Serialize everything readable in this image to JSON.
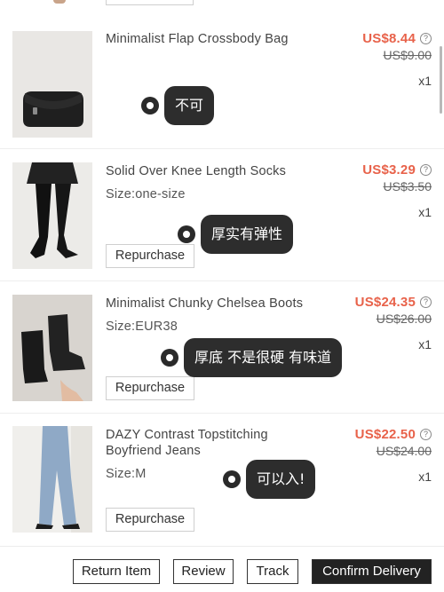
{
  "items": [
    {
      "title": "Minimalist Flap Crossbody Bag",
      "size": "",
      "price": "US$8.44",
      "original_price": "US$9.00",
      "quantity": "x1",
      "repurchase_label": "",
      "note": "不可"
    },
    {
      "title": "Solid Over Knee Length Socks",
      "size": "Size:one-size",
      "price": "US$3.29",
      "original_price": "US$3.50",
      "quantity": "x1",
      "repurchase_label": "Repurchase",
      "note": "厚实有弹性"
    },
    {
      "title": "Minimalist Chunky Chelsea Boots",
      "size": "Size:EUR38",
      "price": "US$24.35",
      "original_price": "US$26.00",
      "quantity": "x1",
      "repurchase_label": "Repurchase",
      "note": "厚底 不是很硬 有味道"
    },
    {
      "title": "DAZY Contrast Topstitching Boyfriend Jeans",
      "size": "Size:M",
      "price": "US$22.50",
      "original_price": "US$24.00",
      "quantity": "x1",
      "repurchase_label": "Repurchase",
      "note": "可以入!"
    }
  ],
  "icons": {
    "price_info": "info-circle-icon",
    "tag_marker": "tag-dot-icon"
  },
  "colors": {
    "price": "#e8624a",
    "primary_button": "#222222",
    "tag_bubble": "#2d2d2d"
  },
  "actions": {
    "return_item": "Return Item",
    "review": "Review",
    "track": "Track",
    "confirm_delivery": "Confirm Delivery"
  }
}
